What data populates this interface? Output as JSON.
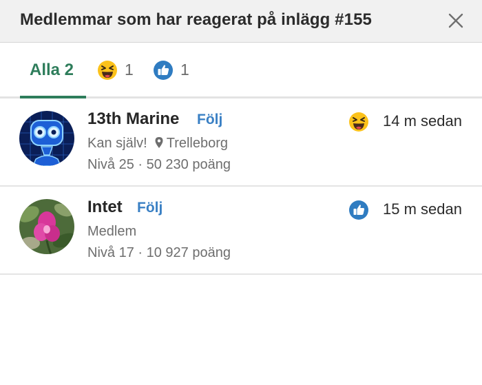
{
  "dialog": {
    "title": "Medlemmar som har reagerat på inlägg #155",
    "close_icon": "close-icon"
  },
  "tabs": [
    {
      "label": "Alla 2",
      "selected": true
    },
    {
      "icon": "laughing-emoji-icon",
      "count": "1"
    },
    {
      "icon": "thumbs-up-icon",
      "count": "1"
    }
  ],
  "members": [
    {
      "name": "13th Marine",
      "follow_label": "Följ",
      "subtitle": "Kan själv!",
      "location": "Trelleborg",
      "level": "Nivå 25",
      "points": "50 230 poäng",
      "separator": "·",
      "reaction_icon": "laughing-emoji-icon",
      "time": "14 m sedan"
    },
    {
      "name": "Intet",
      "follow_label": "Följ",
      "subtitle": "Medlem",
      "level": "Nivå 17",
      "points": "10 927 poäng",
      "separator": "·",
      "reaction_icon": "thumbs-up-icon",
      "time": "15 m sedan"
    }
  ],
  "colors": {
    "accent_green": "#2e7d5b",
    "link_blue": "#3a80c4",
    "header_bg": "#f1f1f1"
  }
}
